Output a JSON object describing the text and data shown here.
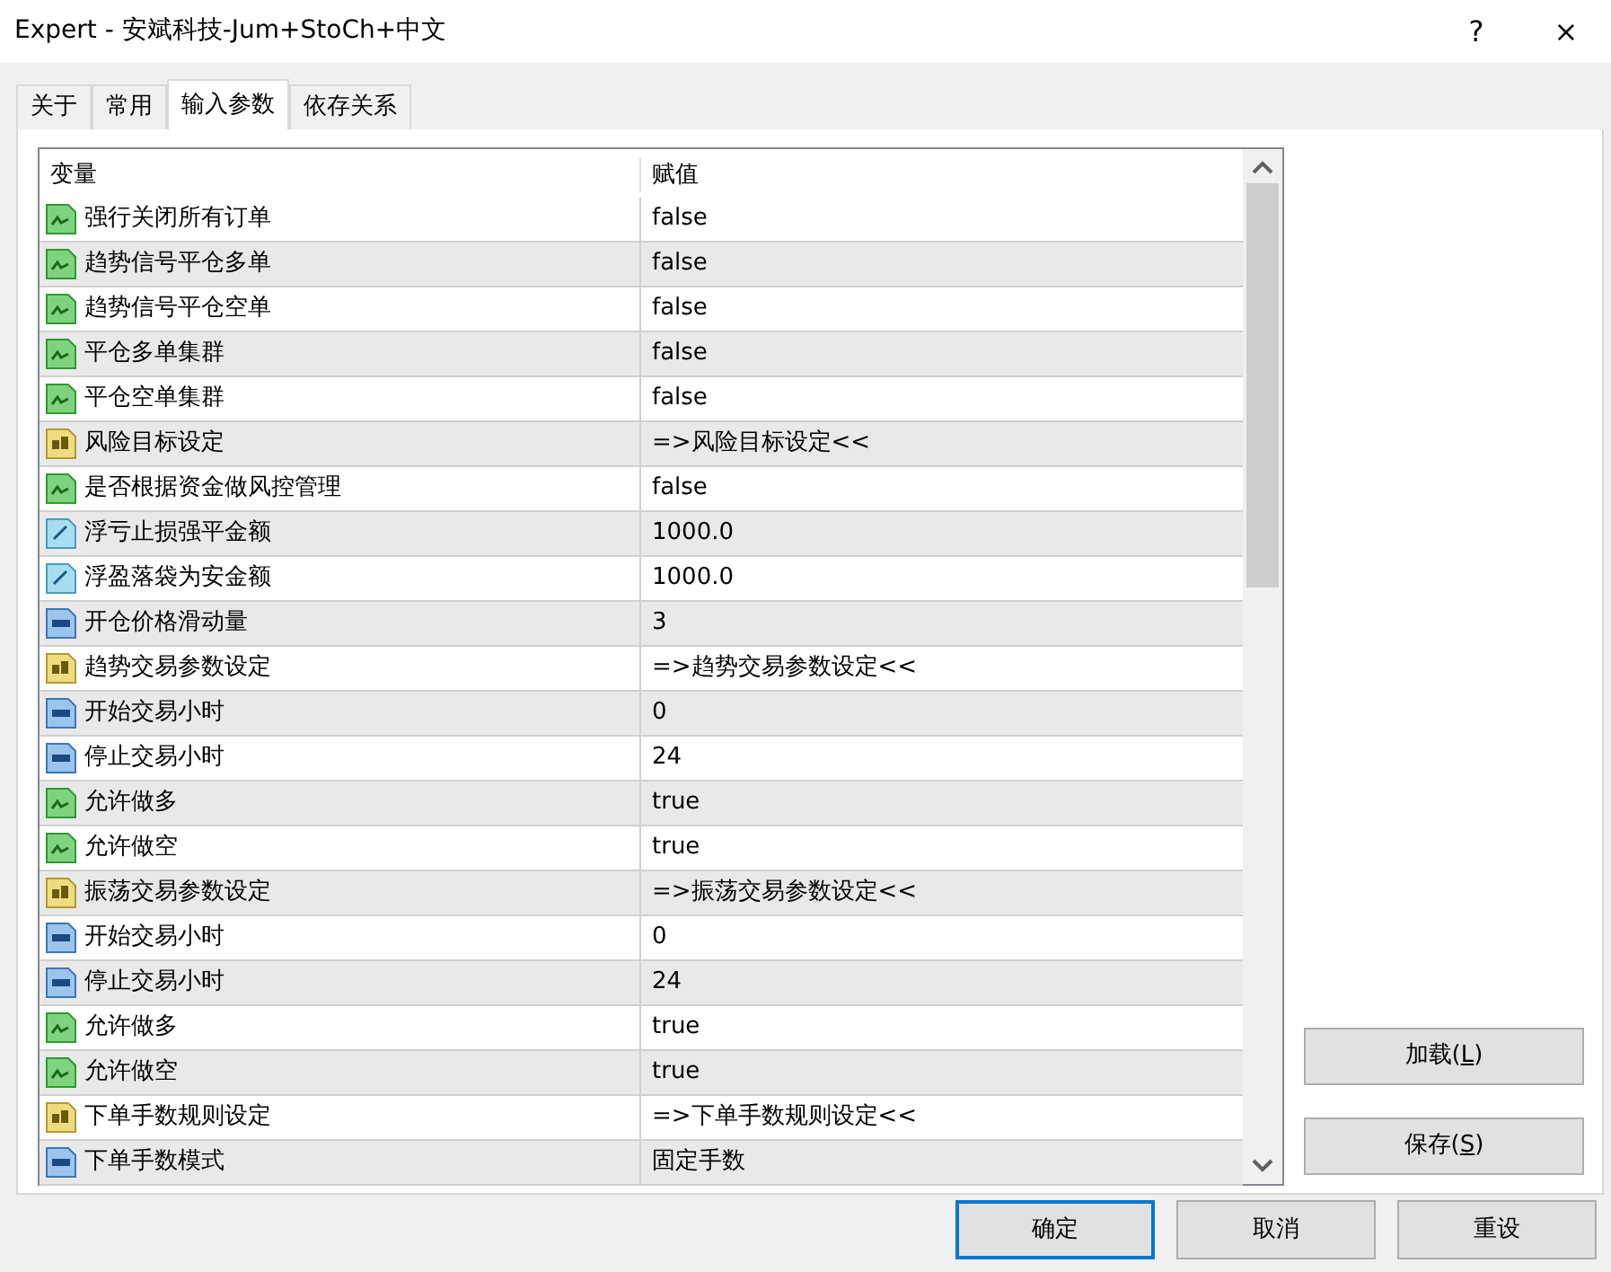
{
  "window": {
    "title": "Expert - 安斌科技-Jum+StoCh+中文",
    "help": "?",
    "close": "×"
  },
  "tabs": [
    {
      "label": "关于",
      "selected": false
    },
    {
      "label": "常用",
      "selected": false
    },
    {
      "label": "输入参数",
      "selected": true
    },
    {
      "label": "依存关系",
      "selected": false
    }
  ],
  "table": {
    "columns": [
      "变量",
      "赋值"
    ],
    "rows": [
      {
        "kind": "bool",
        "name": "强行关闭所有订单",
        "value": "false"
      },
      {
        "kind": "bool",
        "name": "趋势信号平仓多单",
        "value": "false"
      },
      {
        "kind": "bool",
        "name": "趋势信号平仓空单",
        "value": "false"
      },
      {
        "kind": "bool",
        "name": "平仓多单集群",
        "value": "false"
      },
      {
        "kind": "bool",
        "name": "平仓空单集群",
        "value": "false"
      },
      {
        "kind": "string",
        "name": "风险目标设定",
        "value": "=>风险目标设定<<"
      },
      {
        "kind": "bool",
        "name": "是否根据资金做风控管理",
        "value": "false"
      },
      {
        "kind": "double",
        "name": "浮亏止损强平金额",
        "value": "1000.0"
      },
      {
        "kind": "double",
        "name": "浮盈落袋为安金额",
        "value": "1000.0"
      },
      {
        "kind": "int",
        "name": "开仓价格滑动量",
        "value": "3"
      },
      {
        "kind": "string",
        "name": "趋势交易参数设定",
        "value": "=>趋势交易参数设定<<"
      },
      {
        "kind": "int",
        "name": "开始交易小时",
        "value": "0"
      },
      {
        "kind": "int",
        "name": "停止交易小时",
        "value": "24"
      },
      {
        "kind": "bool",
        "name": "允许做多",
        "value": "true"
      },
      {
        "kind": "bool",
        "name": "允许做空",
        "value": "true"
      },
      {
        "kind": "string",
        "name": "振荡交易参数设定",
        "value": "=>振荡交易参数设定<<"
      },
      {
        "kind": "int",
        "name": "开始交易小时",
        "value": "0"
      },
      {
        "kind": "int",
        "name": "停止交易小时",
        "value": "24"
      },
      {
        "kind": "bool",
        "name": "允许做多",
        "value": "true"
      },
      {
        "kind": "bool",
        "name": "允许做空",
        "value": "true"
      },
      {
        "kind": "string",
        "name": "下单手数规则设定",
        "value": "=>下单手数规则设定<<"
      },
      {
        "kind": "int",
        "name": "下单手数模式",
        "value": "固定手数"
      }
    ]
  },
  "side_buttons": [
    "加载(**L**)",
    "保存(**S**)"
  ],
  "footer_buttons": [
    "确定",
    "取消",
    "重设"
  ]
}
